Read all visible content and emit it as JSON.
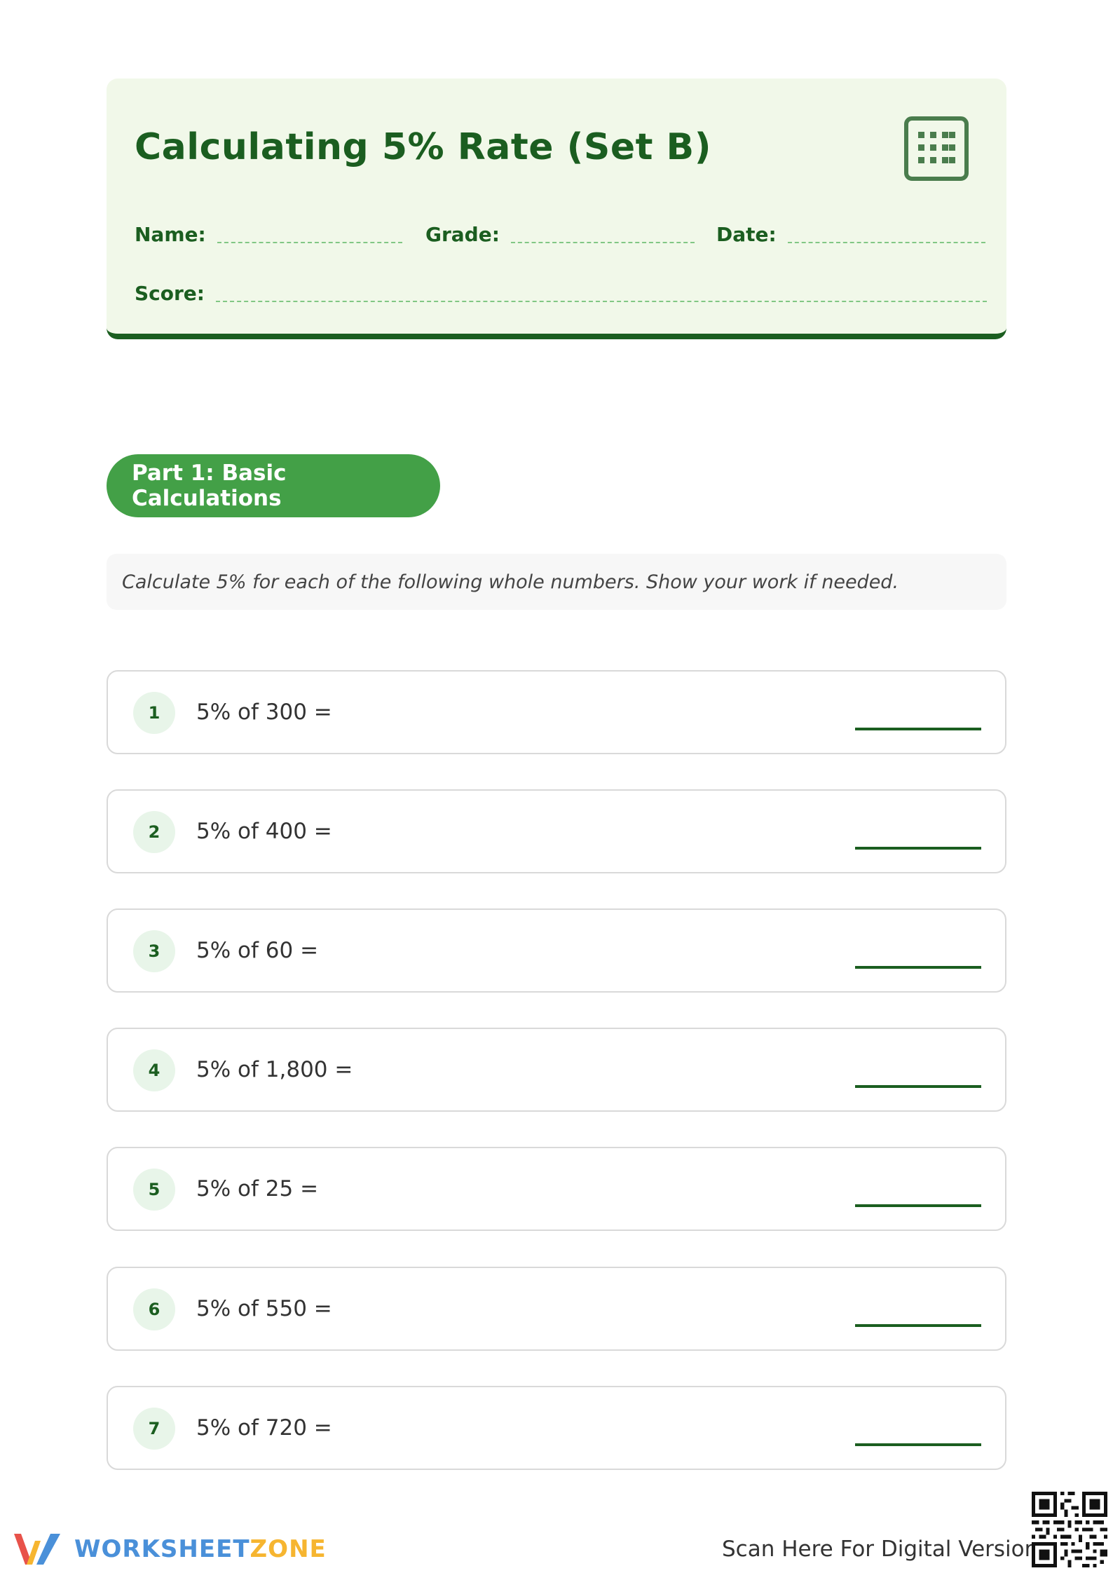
{
  "header": {
    "title": "Calculating 5% Rate (Set B)",
    "icon": "calculator-icon",
    "fields": {
      "name_label": "Name:",
      "grade_label": "Grade:",
      "date_label": "Date:",
      "score_label": "Score:"
    }
  },
  "part1": {
    "title": "Part 1: Basic Calculations",
    "instructions": "Calculate 5% for each of the following whole numbers. Show your work if needed.",
    "problems": [
      {
        "number": "1",
        "text": "5% of 300 ="
      },
      {
        "number": "2",
        "text": "5% of 400 ="
      },
      {
        "number": "3",
        "text": "5% of 60 ="
      },
      {
        "number": "4",
        "text": "5% of 1,800 ="
      },
      {
        "number": "5",
        "text": "5% of 25 ="
      },
      {
        "number": "6",
        "text": "5% of 550 ="
      },
      {
        "number": "7",
        "text": "5% of 720 ="
      }
    ]
  },
  "footer": {
    "brand_part1": "WORKSHEET",
    "brand_part2": "ZONE",
    "scan_text": "Scan Here For Digital Version"
  },
  "colors": {
    "primary_dark": "#1b5e20",
    "primary": "#43a047",
    "header_bg": "#f1f8e9",
    "brand_blue": "#4a90d9",
    "brand_yellow": "#f6b530"
  }
}
